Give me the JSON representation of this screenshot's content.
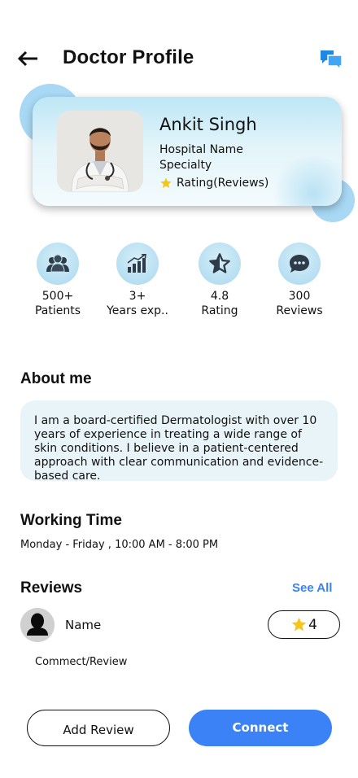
{
  "header": {
    "title": "Doctor Profile",
    "back_icon": "arrow-left-icon",
    "chat_icon": "chat-bubbles-icon"
  },
  "doctor": {
    "name": "Ankit Singh",
    "hospital": "Hospital Name",
    "specialty": "Specialty",
    "rating_text": "Rating(Reviews)"
  },
  "stats": [
    {
      "icon": "group-icon",
      "value": "500+",
      "label": "Patients"
    },
    {
      "icon": "bar-chart-icon",
      "value": "3+",
      "label": "Years exp.."
    },
    {
      "icon": "star-badge-icon",
      "value": "4.8",
      "label": "Rating"
    },
    {
      "icon": "chat-bubble-icon",
      "value": "300",
      "label": "Reviews"
    }
  ],
  "about": {
    "title": "About me",
    "text": "I am a board-certified Dermatologist with over 10 years of experience in treating a wide range of skin conditions. I believe in a patient-centered approach with clear communication and evidence-based care."
  },
  "working": {
    "title": "Working Time",
    "text": "Monday - Friday , 10:00 AM - 8:00 PM"
  },
  "reviews": {
    "title": "Reviews",
    "see_all": "See All",
    "items": [
      {
        "name": "Name",
        "rating": "4",
        "text": "Commect/Review"
      }
    ]
  },
  "actions": {
    "add_review": "Add Review",
    "connect": "Connect"
  },
  "colors": {
    "accent": "#3b82f6",
    "card_light": "#bde6f5",
    "star": "#f5c518",
    "about_bg": "#e9f4f8"
  }
}
